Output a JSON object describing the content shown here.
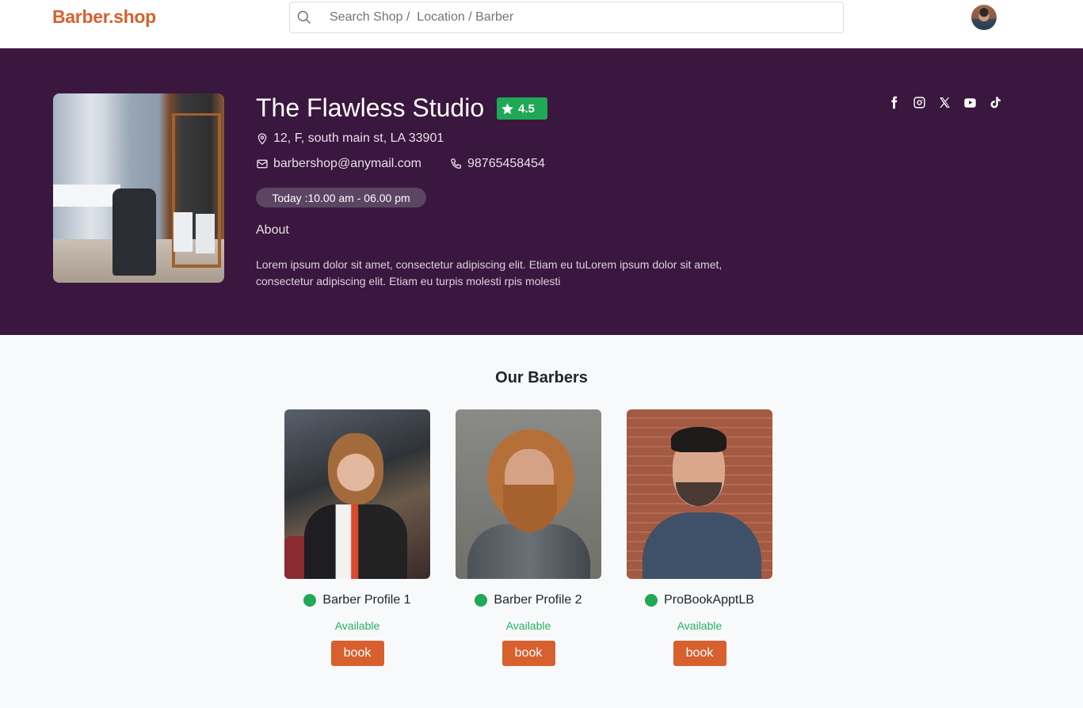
{
  "header": {
    "logo": "Barber.shop",
    "search_placeholder": "Search Shop /  Location / Barber",
    "search_value": "",
    "avatar_icon": "user-avatar"
  },
  "shop": {
    "name": "The Flawless Studio",
    "rating": "4.5",
    "rating_icon": "star-icon",
    "address": "12, F, south main st, LA 33901",
    "email": "barbershop@anymail.com",
    "phone": "98765458454",
    "hours": "Today :10.00 am - 06.00 pm",
    "about_title": "About",
    "about_text": "Lorem ipsum dolor sit amet, consectetur adipiscing elit. Etiam eu tuLorem ipsum dolor sit amet, consectetur adipiscing elit. Etiam eu turpis molesti rpis molesti",
    "social": [
      "facebook-icon",
      "instagram-icon",
      "x-icon",
      "youtube-icon",
      "tiktok-icon"
    ]
  },
  "barbers_section": {
    "title": "Our Barbers",
    "barbers": [
      {
        "name": "Barber Profile 1",
        "status": "Available",
        "book_label": "book"
      },
      {
        "name": "Barber Profile 2",
        "status": "Available",
        "book_label": "book"
      },
      {
        "name": "ProBookApptLB",
        "status": "Available",
        "book_label": "book"
      }
    ]
  },
  "colors": {
    "brand": "#d7602e",
    "hero_bg": "#3a173e",
    "available": "#1fa855",
    "page_bg": "#f8f9fb"
  }
}
